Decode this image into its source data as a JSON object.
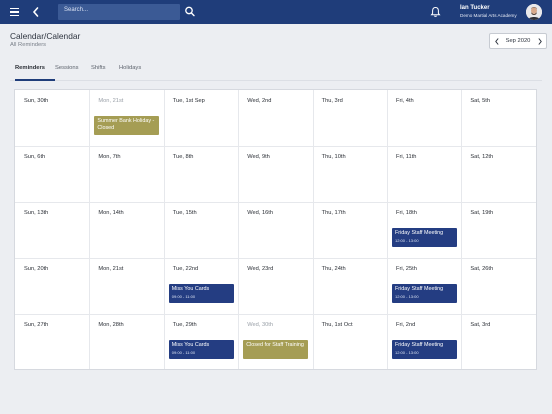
{
  "header": {
    "search_placeholder": "Search...",
    "user_name": "Ian Tucker",
    "user_org": "Demo Martial Arts Academy"
  },
  "page": {
    "title": "Calendar/Calendar",
    "subtitle": "All Reminders"
  },
  "month_nav": {
    "label": "Sep 2020"
  },
  "tabs": [
    {
      "label": "Reminders",
      "active": true
    },
    {
      "label": "Sessions",
      "active": false
    },
    {
      "label": "Shifts",
      "active": false
    },
    {
      "label": "Holidays",
      "active": false
    }
  ],
  "colors": {
    "brand": "#1f3d7a",
    "event_blue": "#243d82",
    "event_olive": "#a59d54"
  },
  "weeks": [
    {
      "days": [
        {
          "label": "Sun, 30th"
        },
        {
          "label": "Mon, 21st",
          "muted": true,
          "event": {
            "title": "Summer Bank Holiday - Closed",
            "color": "olive"
          }
        },
        {
          "label": "Tue, 1st Sep"
        },
        {
          "label": "Wed, 2nd"
        },
        {
          "label": "Thu, 3rd"
        },
        {
          "label": "Fri, 4th"
        },
        {
          "label": "Sat, 5th"
        }
      ]
    },
    {
      "days": [
        {
          "label": "Sun, 6th"
        },
        {
          "label": "Mon, 7th"
        },
        {
          "label": "Tue, 8th"
        },
        {
          "label": "Wed, 9th"
        },
        {
          "label": "Thu, 10th"
        },
        {
          "label": "Fri, 11th"
        },
        {
          "label": "Sat, 12th"
        }
      ]
    },
    {
      "days": [
        {
          "label": "Sun, 13th"
        },
        {
          "label": "Mon, 14th"
        },
        {
          "label": "Tue, 15th"
        },
        {
          "label": "Wed, 16th"
        },
        {
          "label": "Thu, 17th"
        },
        {
          "label": "Fri, 18th",
          "event": {
            "title": "Friday Staff Meeting",
            "time": "12:00 - 13:00",
            "color": "blue"
          }
        },
        {
          "label": "Sat, 19th"
        }
      ]
    },
    {
      "days": [
        {
          "label": "Sun, 20th"
        },
        {
          "label": "Mon, 21st"
        },
        {
          "label": "Tue, 22nd",
          "event": {
            "title": "Miss You Cards",
            "time": "09:00 - 11:00",
            "color": "blue"
          }
        },
        {
          "label": "Wed, 23rd"
        },
        {
          "label": "Thu, 24th"
        },
        {
          "label": "Fri, 25th",
          "event": {
            "title": "Friday Staff Meeting",
            "time": "12:00 - 13:00",
            "color": "blue"
          }
        },
        {
          "label": "Sat, 26th"
        }
      ]
    },
    {
      "days": [
        {
          "label": "Sun, 27th"
        },
        {
          "label": "Mon, 28th"
        },
        {
          "label": "Tue, 29th",
          "event": {
            "title": "Miss You Cards",
            "time": "09:00 - 11:00",
            "color": "blue"
          }
        },
        {
          "label": "Wed, 30th",
          "muted": true,
          "event": {
            "title": "Closed for Staff Training",
            "color": "olive"
          }
        },
        {
          "label": "Thu, 1st Oct"
        },
        {
          "label": "Fri, 2nd",
          "event": {
            "title": "Friday Staff Meeting",
            "time": "12:00 - 13:00",
            "color": "blue"
          }
        },
        {
          "label": "Sat, 3rd"
        }
      ]
    }
  ]
}
